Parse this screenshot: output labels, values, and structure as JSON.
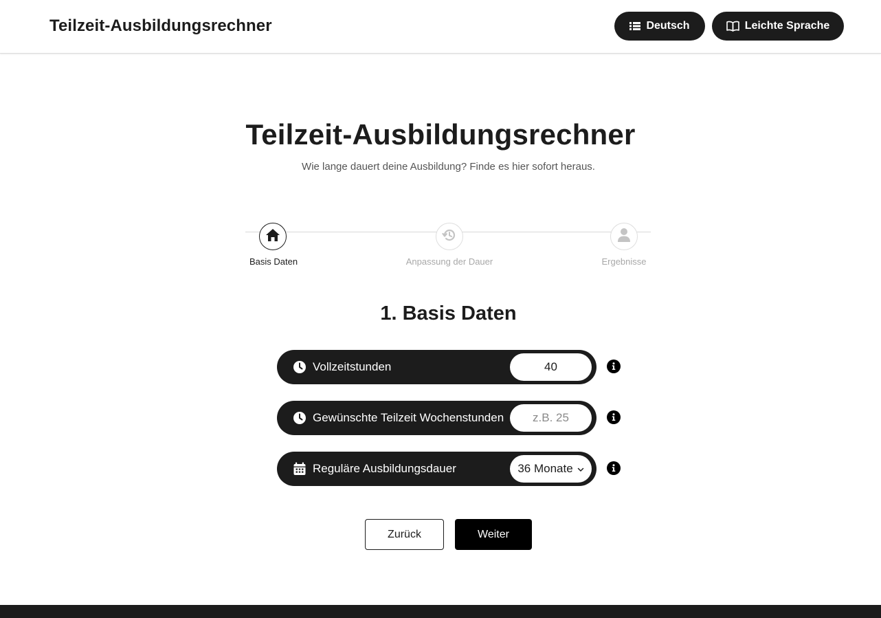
{
  "header": {
    "brand": "Teilzeit-Ausbildungsrechner",
    "language_button": "Deutsch",
    "easy_language_button": "Leichte Sprache",
    "language_icon": "list-icon",
    "easy_language_icon": "book-open-icon"
  },
  "hero": {
    "title": "Teilzeit-Ausbildungsrechner",
    "subtitle": "Wie lange dauert deine Ausbildung? Finde es hier sofort heraus."
  },
  "stepper": {
    "current_step": 1,
    "steps": [
      {
        "label": "Basis Daten",
        "icon": "home-icon",
        "state": "active"
      },
      {
        "label": "Anpassung der Dauer",
        "icon": "history-icon",
        "state": "inactive"
      },
      {
        "label": "Ergebnisse",
        "icon": "user-icon",
        "state": "inactive"
      }
    ]
  },
  "section": {
    "title": "1. Basis Daten"
  },
  "form": {
    "fields": [
      {
        "label": "Vollzeitstunden",
        "icon": "clock-icon",
        "value": "40",
        "placeholder": ""
      },
      {
        "label": "Gewünschte Teilzeit Wochenstunden",
        "icon": "clock-icon",
        "value": "",
        "placeholder": "z.B. 25"
      },
      {
        "label": "Reguläre Ausbildungsdauer",
        "icon": "calendar-icon",
        "value": "36 Monate",
        "placeholder": ""
      }
    ]
  },
  "actions": {
    "back_label": "Zurück",
    "next_label": "Weiter"
  },
  "colors": {
    "primary": "#1c1c1c",
    "background": "#ffffff",
    "inactive": "#a8a8a8"
  }
}
